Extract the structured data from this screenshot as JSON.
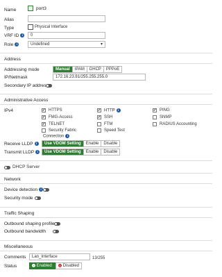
{
  "name": {
    "label": "Name",
    "value": "port3"
  },
  "alias": {
    "label": "Alias",
    "value": ""
  },
  "type": {
    "label": "Type",
    "value": "Physical Interface"
  },
  "vrf": {
    "label": "VRF ID",
    "value": "0"
  },
  "role": {
    "label": "Role",
    "value": "Undefined"
  },
  "address": {
    "title": "Address",
    "mode_label": "Addressing mode",
    "modes": [
      "Manual",
      "IPAM",
      "DHCP",
      "PPPoE"
    ],
    "active_mode": "Manual",
    "ip_label": "IP/Netmask",
    "ip_value": "172.16.23.81/255.255.255.0",
    "secondary_label": "Secondary IP address"
  },
  "admin": {
    "title": "Administrative Access",
    "ipv4_label": "IPv4",
    "options": [
      {
        "label": "HTTPS",
        "checked": true
      },
      {
        "label": "HTTP",
        "checked": true
      },
      {
        "label": "PING",
        "checked": true
      },
      {
        "label": "FMG-Access",
        "checked": true
      },
      {
        "label": "SSH",
        "checked": true
      },
      {
        "label": "SNMP",
        "checked": false
      },
      {
        "label": "TELNET",
        "checked": true
      },
      {
        "label": "FTM",
        "checked": false
      },
      {
        "label": "RADIUS Accounting",
        "checked": false
      },
      {
        "label": "Security Fabric",
        "checked": false
      },
      {
        "label": "Speed Test",
        "checked": false
      }
    ],
    "fabric_line2": "Connection",
    "receive_label": "Receive LLDP",
    "transmit_label": "Transmit LLDP",
    "lldp_options": [
      "Use VDOM Setting",
      "Enable",
      "Disable"
    ]
  },
  "dhcp": {
    "title": "DHCP Server"
  },
  "network": {
    "title": "Network",
    "device_detection": "Device detection",
    "security_mode": "Security mode"
  },
  "traffic": {
    "title": "Traffic Shaping",
    "outbound_profile": "Outbound shaping profile",
    "outbound_bandwidth": "Outbound bandwidth"
  },
  "misc": {
    "title": "Miscellaneous",
    "comments_label": "Comments",
    "comments_value": "Lan_Interface",
    "counter": "13/255",
    "status_label": "Status",
    "enabled": "Enabled",
    "disabled": "Disabled"
  },
  "icons": {
    "info": "i",
    "check": "✔",
    "dropdown": "▾"
  },
  "colors": {
    "accent_green": "#2e7d32",
    "info_blue": "#1e5aa8",
    "disabled_red": "#d32f2f"
  }
}
